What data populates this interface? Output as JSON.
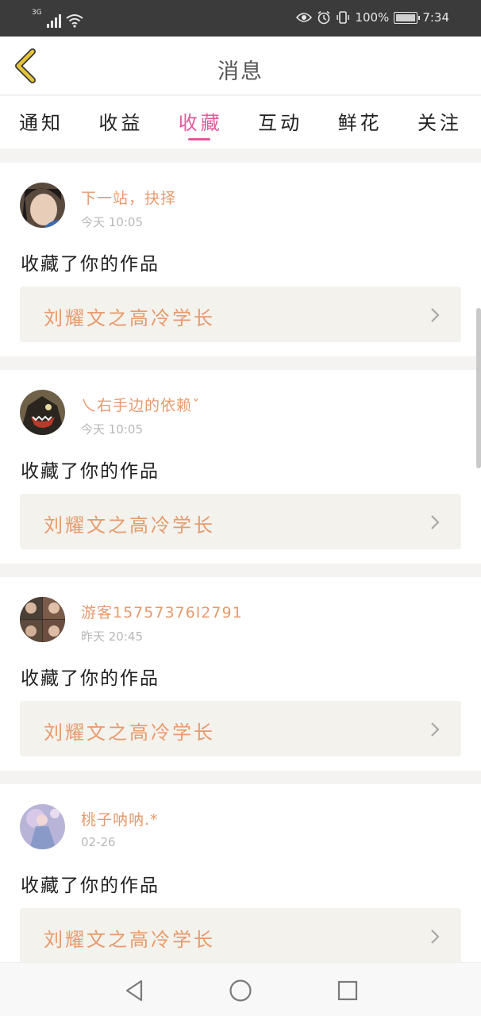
{
  "status_bar": {
    "network": "3G",
    "battery_text": "100%",
    "time": "7:34"
  },
  "header": {
    "title": "消息"
  },
  "tabs": [
    {
      "label": "通知",
      "active": false
    },
    {
      "label": "收益",
      "active": false
    },
    {
      "label": "收藏",
      "active": true
    },
    {
      "label": "互动",
      "active": false
    },
    {
      "label": "鲜花",
      "active": false
    },
    {
      "label": "关注",
      "active": false
    }
  ],
  "items": [
    {
      "user": "下一站，抉择",
      "time": "今天 10:05",
      "action": "收藏了你的作品",
      "work": "刘耀文之高冷学长"
    },
    {
      "user": "乀右手边的依赖ˇ",
      "time": "今天 10:05",
      "action": "收藏了你的作品",
      "work": "刘耀文之高冷学长"
    },
    {
      "user": "游客15757376I2791",
      "time": "昨天 20:45",
      "action": "收藏了你的作品",
      "work": "刘耀文之高冷学长"
    },
    {
      "user": "桃子呐呐.*",
      "time": "02-26",
      "action": "收藏了你的作品",
      "work": "刘耀文之高冷学长"
    }
  ],
  "colors": {
    "accent": "#e05a9a",
    "username": "#e79a6d",
    "back_icon": "#e6c43a"
  }
}
